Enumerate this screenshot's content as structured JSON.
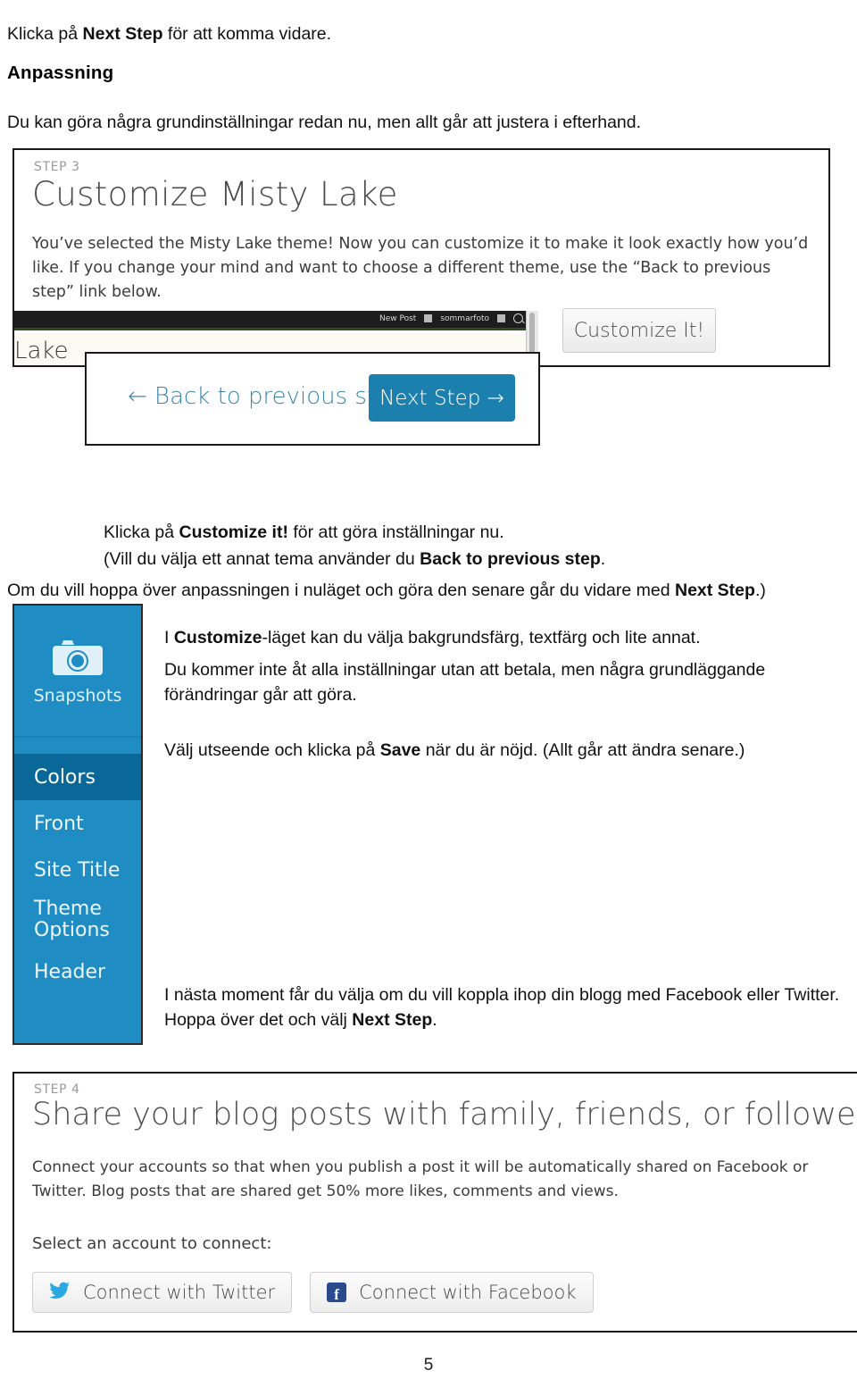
{
  "document": {
    "page_number": "5",
    "intro_paragraph": {
      "pre": "Klicka på ",
      "bold": "Next Step",
      "post": " för att komma vidare."
    },
    "section_heading": "Anpassning",
    "anpassning_paragraph": "Du kan göra några grundinställningar redan nu, men allt går att justera i efterhand."
  },
  "step3_screenshot": {
    "step_label": "STEP 3",
    "title": "Customize Misty Lake",
    "body": "You’ve selected the Misty Lake theme! Now you can customize it to make it look exactly how you’d like. If you change your mind and want to choose a different theme, use the “Back to previous step” link below.",
    "adminbar": {
      "new_post": "New Post",
      "site_name": "sommarfoto"
    },
    "site_title_fragment": "Lake",
    "customize_button": "Customize It!"
  },
  "nav_popup": {
    "back_link": "← Back to previous step",
    "next_button": "Next Step →"
  },
  "mid_paragraphs": {
    "klicka_pre": "Klicka på ",
    "klicka_bold": "Customize it!",
    "klicka_post": "  för att göra inställningar nu.",
    "vill_pre": "(Vill du välja ett annat tema använder du ",
    "vill_bold": "Back to previous step",
    "vill_post": ".",
    "om_pre": "Om du vill hoppa över anpassningen i nuläget och göra den senare går du vidare med ",
    "om_bold": "Next Step",
    "om_post": ".)"
  },
  "customizer_sidebar": {
    "snapshots_label": "Snapshots",
    "snapshots_icon": "camera-icon",
    "items": [
      {
        "label": "Colors",
        "active": true
      },
      {
        "label": "Front",
        "active": false
      },
      {
        "label": "Site Title",
        "active": false
      },
      {
        "label": "Theme Options",
        "active": false
      },
      {
        "label": "Header",
        "active": false
      }
    ],
    "colors": {
      "background": "#1f8dc4",
      "active_background": "#0a6898"
    }
  },
  "right_paragraphs": {
    "cust_pre": "I ",
    "cust_bold": "Customize",
    "cust_post": "-läget kan du välja bakgrundsfärg, textfärg och lite annat.",
    "betala": "Du kommer inte åt alla inställningar utan att betala, men några grundläggande förändringar går att göra.",
    "valj_pre": "Välj utseende och klicka på ",
    "valj_bold": "Save",
    "valj_post": " när du är nöjd. (Allt går att ändra senare.)",
    "nasta_pre": "I nästa moment får du välja om du vill koppla ihop din blogg med Facebook eller Twitter. Hoppa över det och välj ",
    "nasta_bold": "Next Step",
    "nasta_post": "."
  },
  "step4_screenshot": {
    "step_label": "STEP 4",
    "title": "Share your blog posts with family, friends, or followers",
    "body": "Connect your accounts so that when you publish a post it will be automatically shared on Facebook or Twitter. Blog posts that are shared get 50% more likes, comments and views.",
    "select_label": "Select an account to connect:",
    "buttons": [
      {
        "label": "Connect with Twitter",
        "icon": "twitter-bird-icon"
      },
      {
        "label": "Connect with Facebook",
        "icon": "facebook-f-icon"
      }
    ]
  },
  "accent_colors": {
    "link_blue": "#3a87ad",
    "button_blue": "#1b80ae",
    "twitter_blue": "#2aa9e0",
    "facebook_blue": "#2b4a8b"
  }
}
